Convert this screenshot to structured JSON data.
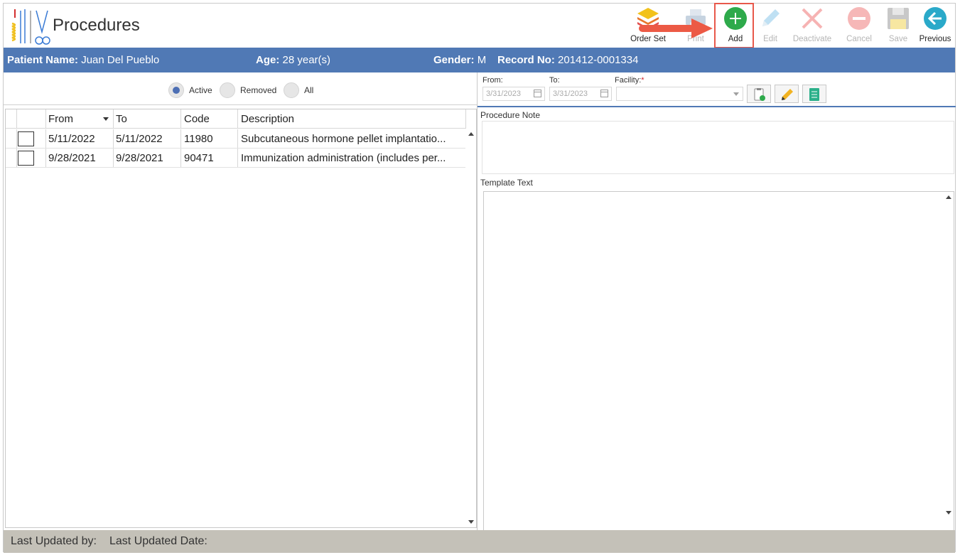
{
  "header": {
    "title": "Procedures"
  },
  "toolbar": {
    "buttons": [
      {
        "label": "Order Set",
        "icon": "layers-icon",
        "enabled": true
      },
      {
        "label": "Print",
        "icon": "printer-icon",
        "enabled": false
      },
      {
        "label": "Add",
        "icon": "plus-circle-icon",
        "enabled": true
      },
      {
        "label": "Edit",
        "icon": "pencil-icon",
        "enabled": false
      },
      {
        "label": "Deactivate",
        "icon": "x-icon",
        "enabled": false
      },
      {
        "label": "Cancel",
        "icon": "minus-circle-icon",
        "enabled": false
      },
      {
        "label": "Save",
        "icon": "floppy-icon",
        "enabled": false
      },
      {
        "label": "Previous",
        "icon": "arrow-left-circle-icon",
        "enabled": true
      }
    ]
  },
  "patient": {
    "name_label": "Patient Name:",
    "name": "Juan Del Pueblo",
    "age_label": "Age:",
    "age": "28 year(s)",
    "gender_label": "Gender:",
    "gender": "M",
    "record_label": "Record No:",
    "record": "201412-0001334"
  },
  "filters": {
    "options": [
      {
        "label": "Active",
        "selected": true
      },
      {
        "label": "Removed",
        "selected": false
      },
      {
        "label": "All",
        "selected": false
      }
    ]
  },
  "grid": {
    "columns": [
      "From",
      "To",
      "Code",
      "Description"
    ],
    "rows": [
      {
        "from": "5/11/2022",
        "to": "5/11/2022",
        "code": "11980",
        "description": "Subcutaneous hormone pellet implantatio..."
      },
      {
        "from": "9/28/2021",
        "to": "9/28/2021",
        "code": "90471",
        "description": "Immunization administration (includes per..."
      }
    ]
  },
  "detail": {
    "from_label": "From:",
    "from_value": "3/31/2023",
    "to_label": "To:",
    "to_value": "3/31/2023",
    "facility_label": "Facility:",
    "facility_required": "*",
    "procedure_note_label": "Procedure Note",
    "template_text_label": "Template Text"
  },
  "footer": {
    "updated_by_label": "Last Updated by:",
    "updated_date_label": "Last Updated Date:"
  },
  "colors": {
    "band": "#5079b5",
    "add_green": "#2eaa4b",
    "previous_teal": "#2aa9c9",
    "highlight_red": "#e8584b",
    "footer": "#c4c1b8"
  }
}
